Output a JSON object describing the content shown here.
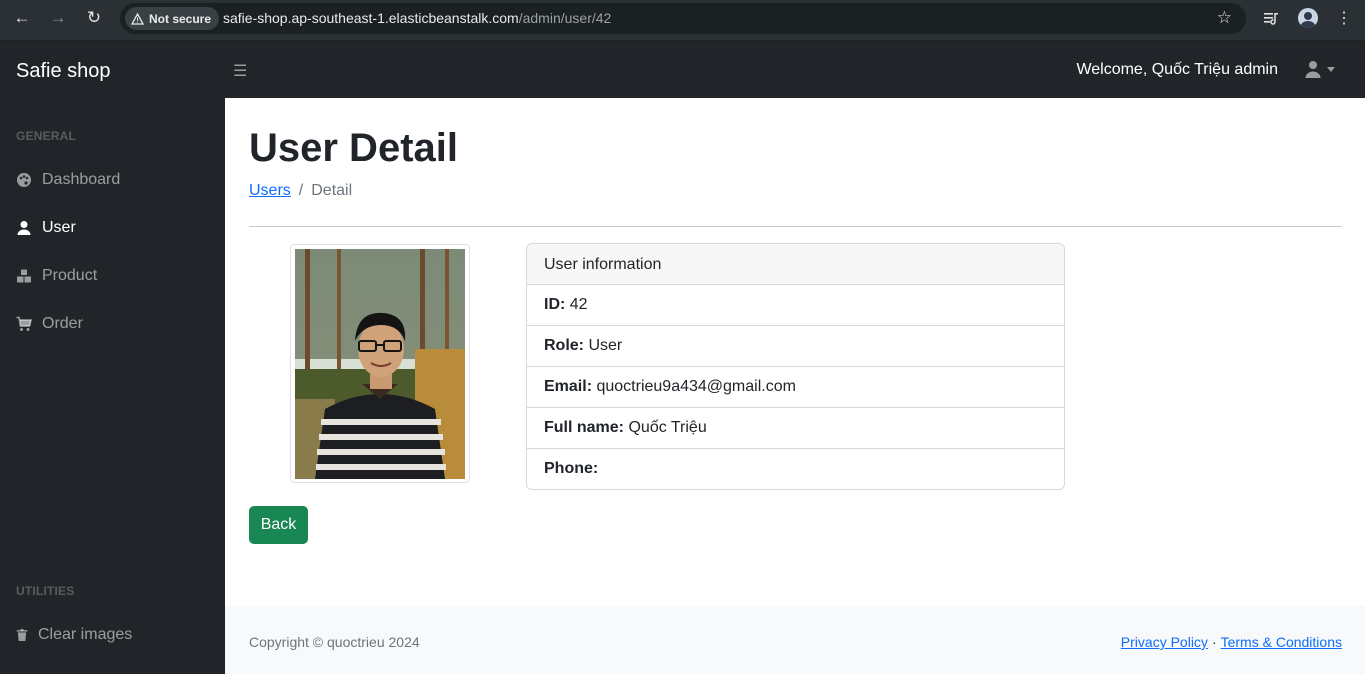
{
  "browser": {
    "security_label": "Not secure",
    "url_host": "safie-shop.ap-southeast-1.elasticbeanstalk.com",
    "url_path": "/admin/user/42"
  },
  "sidebar": {
    "brand": "Safie shop",
    "general_heading": "GENERAL",
    "items": [
      {
        "label": "Dashboard",
        "icon": "palette-icon",
        "active": false
      },
      {
        "label": "User",
        "icon": "user-icon",
        "active": true
      },
      {
        "label": "Product",
        "icon": "boxes-icon",
        "active": false
      },
      {
        "label": "Order",
        "icon": "cart-icon",
        "active": false
      }
    ],
    "utilities_heading": "UTILITIES",
    "utilities": [
      {
        "label": "Clear images",
        "icon": "trash-icon"
      }
    ]
  },
  "topbar": {
    "welcome": "Welcome, Quốc Triệu admin"
  },
  "main": {
    "title": "User Detail",
    "breadcrumb": {
      "link": "Users",
      "separator": "/",
      "current": "Detail"
    },
    "card": {
      "header": "User information",
      "rows": [
        {
          "label": "ID:",
          "value": "42"
        },
        {
          "label": "Role:",
          "value": "User"
        },
        {
          "label": "Email:",
          "value": "quoctrieu9a434@gmail.com"
        },
        {
          "label": "Full name:",
          "value": "Quốc Triệu"
        },
        {
          "label": "Phone:",
          "value": ""
        }
      ]
    },
    "back_label": "Back"
  },
  "footer": {
    "copyright": "Copyright © quoctrieu 2024",
    "privacy": "Privacy Policy",
    "separator": "·",
    "terms": "Terms & Conditions"
  }
}
